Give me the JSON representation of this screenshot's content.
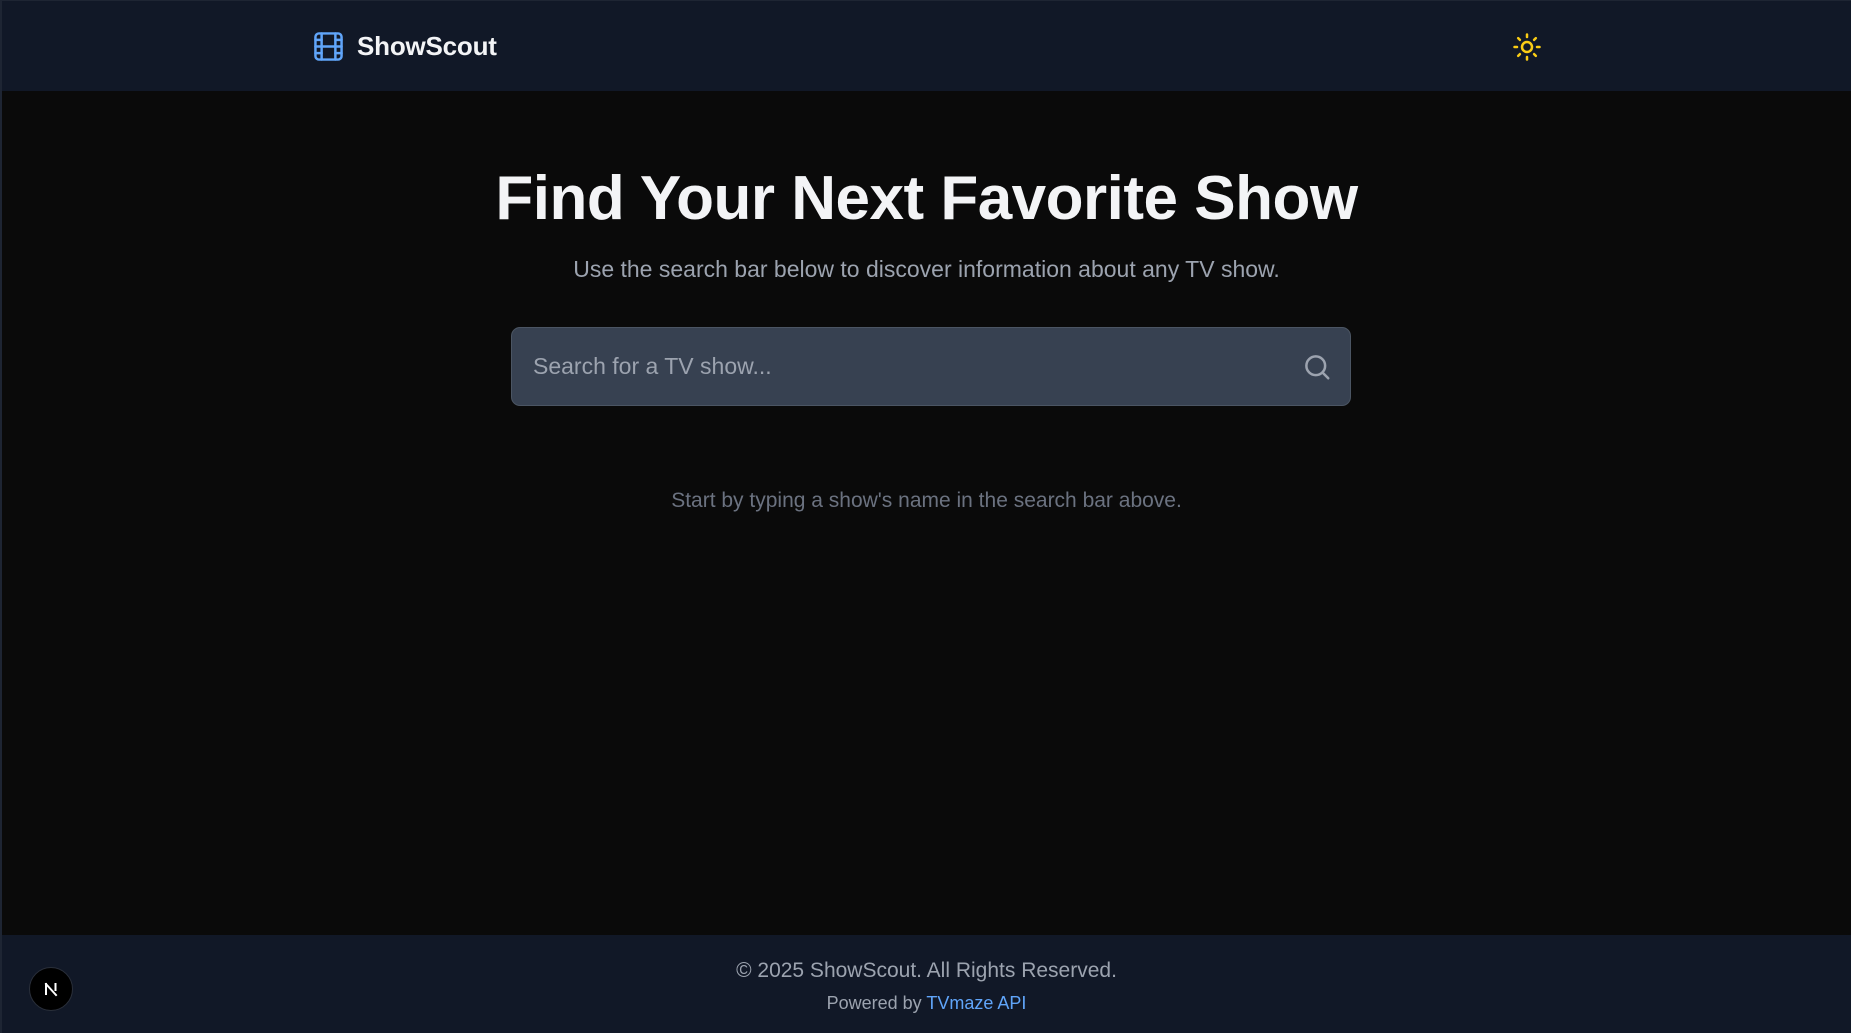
{
  "header": {
    "brand_name": "ShowScout",
    "brand_icon": "film-icon",
    "theme_toggle_icon": "sun-icon"
  },
  "hero": {
    "title": "Find Your Next Favorite Show",
    "subtitle": "Use the search bar below to discover information about any TV show."
  },
  "search": {
    "placeholder": "Search for a TV show...",
    "value": "",
    "icon": "search-icon"
  },
  "empty_state": {
    "hint": "Start by typing a show's name in the search bar above."
  },
  "footer": {
    "copyright": "© 2025 ShowScout. All Rights Reserved.",
    "powered_prefix": "Powered by ",
    "powered_link": "TVmaze API"
  },
  "dev_badge": {
    "letter": "N",
    "icon": "nextjs-icon"
  },
  "colors": {
    "background": "#0a0a0a",
    "header_bg": "#111827",
    "accent": "#60a5fa",
    "sun": "#facc15",
    "search_bg": "#374151"
  }
}
